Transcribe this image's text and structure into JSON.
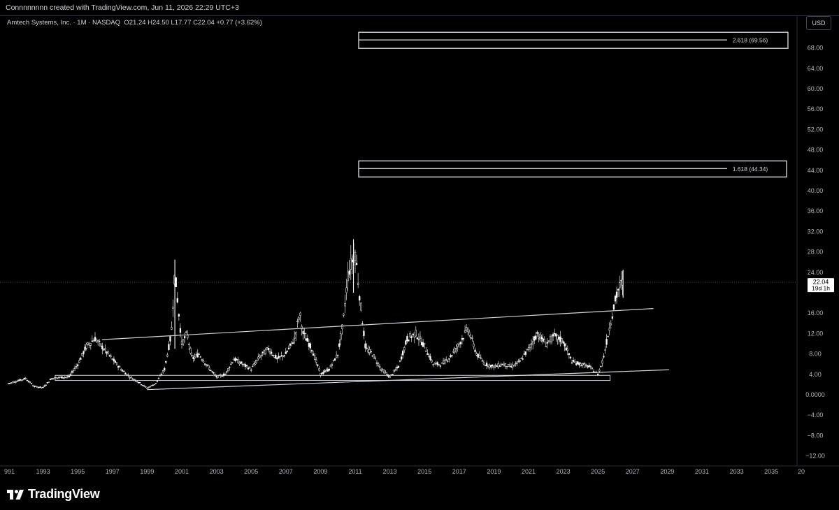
{
  "header": {
    "credit": "Connnnnnnn created with TradingView.com, Jun 11, 2026 22:29 UTC+3"
  },
  "legend": {
    "symbol": "Amtech Systems, Inc. · 1M · NASDAQ",
    "ohlc": "O21.24  H24.50  L17.77  C22.04  +0.77 (+3.62%)"
  },
  "currency": "USD",
  "price_axis": {
    "labels": [
      "68.00",
      "64.00",
      "60.00",
      "56.00",
      "52.00",
      "48.00",
      "44.00",
      "40.00",
      "36.00",
      "32.00",
      "28.00",
      "24.00",
      "16.00",
      "12.00",
      "8.00",
      "4.00",
      "0.0000",
      "−4.00",
      "−8.00",
      "−12.00"
    ],
    "last_price": "22.04",
    "countdown": "19d 1h"
  },
  "time_axis": {
    "labels": [
      "991",
      "1993",
      "1995",
      "1997",
      "1999",
      "2001",
      "2003",
      "2005",
      "2007",
      "2009",
      "2011",
      "2013",
      "2015",
      "2017",
      "2019",
      "2021",
      "2023",
      "2025",
      "2027",
      "2029",
      "2031",
      "2033",
      "2035",
      "20"
    ]
  },
  "fib_levels": [
    {
      "label": "2.618 (69.56)",
      "price": 69.56
    },
    {
      "label": "1.618 (44.34)",
      "price": 44.34
    }
  ],
  "chart_data": {
    "type": "line",
    "series_kind": "monthly candlesticks",
    "ylim": [
      -14,
      74
    ],
    "xlim": [
      1991,
      2036
    ],
    "x": [
      1991,
      1992,
      1992.5,
      1993,
      1993.5,
      1994,
      1994.5,
      1995,
      1995.5,
      1996,
      1996.5,
      1997,
      1997.5,
      1998,
      1998.5,
      1999,
      1999.5,
      2000,
      2000.4,
      2000.6,
      2001,
      2001.3,
      2001.6,
      2002,
      2002.5,
      2003,
      2003.5,
      2004,
      2004.5,
      2005,
      2005.5,
      2006,
      2006.5,
      2007,
      2007.5,
      2007.8,
      2008,
      2008.5,
      2009,
      2009.5,
      2010,
      2010.3,
      2010.6,
      2011,
      2011.3,
      2011.6,
      2012,
      2012.5,
      2013,
      2013.5,
      2014,
      2014.5,
      2015,
      2015.5,
      2016,
      2016.5,
      2017,
      2017.5,
      2018,
      2018.5,
      2019,
      2019.5,
      2020,
      2020.5,
      2021,
      2021.5,
      2022,
      2022.5,
      2023,
      2023.5,
      2024,
      2024.5,
      2025,
      2025.3,
      2025.6,
      2025.9,
      2026.2,
      2026.45
    ],
    "y": [
      2.2,
      3.2,
      1.6,
      1.4,
      3.2,
      3.4,
      3.5,
      6.0,
      9.5,
      11.0,
      9.0,
      7.0,
      5.0,
      3.5,
      2.5,
      1.3,
      2.2,
      5.0,
      12.0,
      24.0,
      10.0,
      12.0,
      7.0,
      8.0,
      5.5,
      3.5,
      4.0,
      7.0,
      6.0,
      5.0,
      7.5,
      9.0,
      7.0,
      8.0,
      11.0,
      16.0,
      12.0,
      9.0,
      4.0,
      5.0,
      8.0,
      14.0,
      24.0,
      28.0,
      18.0,
      9.0,
      8.0,
      5.0,
      3.5,
      5.5,
      11.0,
      12.0,
      9.5,
      6.0,
      6.0,
      7.5,
      10.0,
      13.0,
      8.0,
      6.0,
      5.5,
      6.0,
      5.5,
      6.5,
      9.0,
      12.0,
      10.0,
      11.5,
      10.5,
      6.5,
      6.0,
      5.5,
      4.0,
      7.0,
      12.0,
      17.0,
      21.0,
      22.04
    ],
    "trendlines": [
      {
        "name": "upper channel",
        "from": [
          1996.4,
          10.8
        ],
        "to": [
          2028.2,
          16.9
        ]
      },
      {
        "name": "lower channel",
        "from": [
          1999.0,
          1.0
        ],
        "to": [
          2029.1,
          4.9
        ]
      }
    ],
    "support_zone": {
      "from_x": 1993.7,
      "to_x": 2025.7,
      "y_low": 2.8,
      "y_high": 3.8
    },
    "last_price": 22.04
  }
}
